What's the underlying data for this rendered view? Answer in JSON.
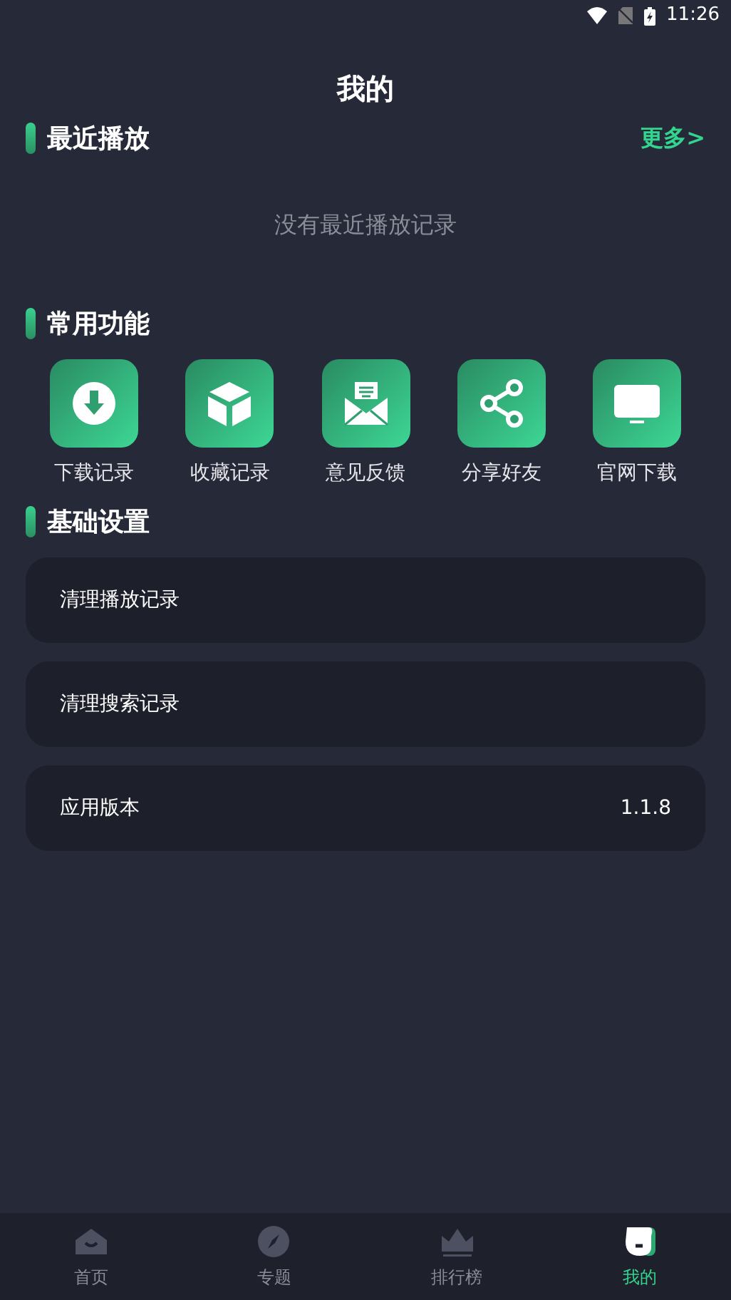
{
  "status_bar": {
    "time": "11:26"
  },
  "title": "我的",
  "recent": {
    "heading": "最近播放",
    "more": "更多>",
    "empty": "没有最近播放记录"
  },
  "functions": {
    "heading": "常用功能",
    "items": [
      {
        "kind": "download",
        "label": "下载记录"
      },
      {
        "kind": "box",
        "label": "收藏记录"
      },
      {
        "kind": "mail",
        "label": "意见反馈"
      },
      {
        "kind": "share",
        "label": "分享好友"
      },
      {
        "kind": "monitor",
        "label": "官网下载"
      }
    ]
  },
  "settings": {
    "heading": "基础设置",
    "rows": [
      {
        "label": "清理播放记录"
      },
      {
        "label": "清理搜索记录"
      },
      {
        "label": "应用版本",
        "value": "1.1.8"
      }
    ]
  },
  "tabs": [
    {
      "kind": "home",
      "label": "首页",
      "selected": false
    },
    {
      "kind": "compass",
      "label": "专题",
      "selected": false
    },
    {
      "kind": "crown",
      "label": "排行榜",
      "selected": false
    },
    {
      "kind": "face",
      "label": "我的",
      "selected": true
    }
  ]
}
